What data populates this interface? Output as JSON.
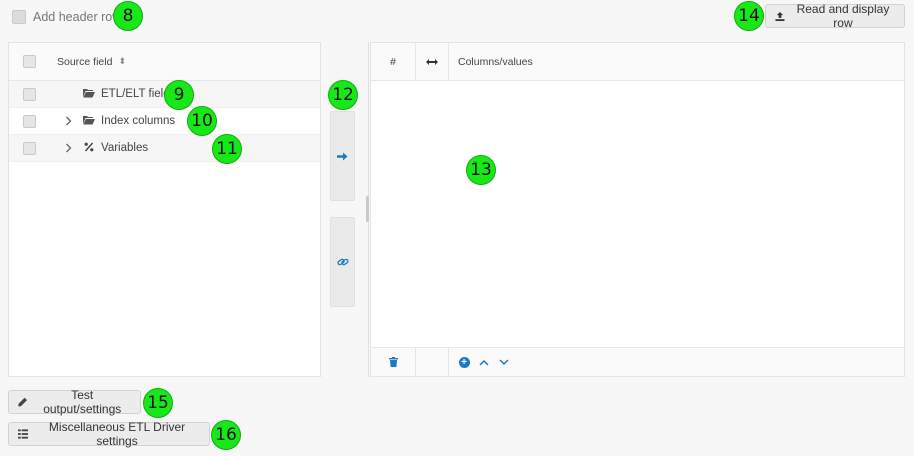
{
  "header_toggle": {
    "label": "Add header row"
  },
  "toolbar": {
    "read_display_label": "Read and display row"
  },
  "source_panel": {
    "header": "Source field",
    "rows": [
      {
        "label": "ETL/ELT fields",
        "icon": "folder-open-icon"
      },
      {
        "label": "Index columns",
        "icon": "folder-open-icon"
      },
      {
        "label": "Variables",
        "icon": "percent-icon"
      }
    ]
  },
  "target_panel": {
    "col_number": "#",
    "col_values": "Columns/values"
  },
  "buttons": {
    "test_label": "Test output/settings",
    "misc_label": "Miscellaneous ETL Driver settings"
  },
  "markers": [
    "8",
    "9",
    "10",
    "11",
    "12",
    "13",
    "14",
    "15",
    "16"
  ],
  "colors": {
    "accent": "#1a7bc0",
    "marker_fill": "#18e818",
    "panel_border": "#e3e3e3"
  }
}
